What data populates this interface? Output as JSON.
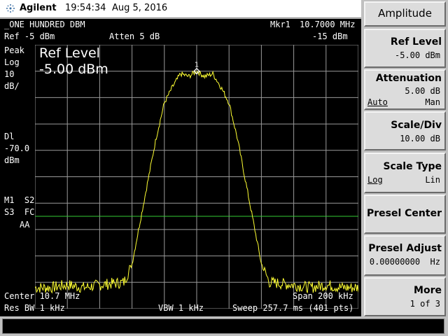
{
  "status_bar": {
    "brand": "Agilent",
    "time": "19:54:34",
    "date": "Aug 5, 2016"
  },
  "display": {
    "title": "_ONE HUNDRED DBM",
    "marker_label": "Mkr1",
    "marker_freq": "10.7000 MHz",
    "ref_label": "Ref -5 dBm",
    "atten_label": "Atten 5 dB",
    "marker_amp": "-15 dBm",
    "left_annotations": {
      "detector": "Peak",
      "scale_mode": "Log",
      "scale_value": "10",
      "scale_unit": "dB/",
      "dl_label": "Dl",
      "dl_value": "-70.0",
      "dl_unit": "dBm",
      "trace_line1": "M1  S2",
      "trace_line2": "S3  FC",
      "trace_line3": "AA"
    },
    "active_function": {
      "label": "Ref Level",
      "value": "-5.00 dBm"
    },
    "marker_number": "1",
    "center": "Center 10.7 MHz",
    "span": "Span 200 kHz",
    "res_bw": "Res BW 1 kHz",
    "vbw": "VBW 1 kHz",
    "sweep": "Sweep 257.7 ms (401 pts)"
  },
  "softkeys": {
    "menu_title": "Amplitude",
    "ref_level": {
      "label": "Ref Level",
      "value": "-5.00 dBm"
    },
    "attenuation": {
      "label": "Attenuation",
      "value": "5.00 dB",
      "auto": "Auto",
      "man": "Man"
    },
    "scale_div": {
      "label": "Scale/Div",
      "value": "10.00 dB"
    },
    "scale_type": {
      "label": "Scale Type",
      "log": "Log",
      "lin": "Lin"
    },
    "presel_center": {
      "label": "Presel Center"
    },
    "presel_adjust": {
      "label": "Presel Adjust",
      "value": "0.00000000  Hz"
    },
    "more": {
      "label": "More",
      "value": "1 of 3"
    }
  },
  "colors": {
    "trace": "#ffff33",
    "display_line": "#33cc33",
    "graticule": "#9a9a9a"
  },
  "chart_data": {
    "type": "line",
    "x_unit": "MHz",
    "y_unit": "dBm",
    "xlim": [
      10.6,
      10.8
    ],
    "ylim": [
      -105,
      -5
    ],
    "display_line_dbm": -70,
    "marker": {
      "label": "1",
      "x": 10.7,
      "y": -15
    },
    "x": [
      10.6,
      10.61,
      10.62,
      10.63,
      10.64,
      10.655,
      10.66,
      10.665,
      10.67,
      10.675,
      10.68,
      10.685,
      10.69,
      10.695,
      10.7,
      10.705,
      10.71,
      10.715,
      10.72,
      10.725,
      10.73,
      10.735,
      10.74,
      10.745,
      10.76,
      10.77,
      10.78,
      10.79,
      10.8
    ],
    "y": [
      -97,
      -97,
      -96,
      -97,
      -96,
      -95,
      -88,
      -72,
      -56,
      -40,
      -27,
      -21,
      -16,
      -17,
      -15,
      -17,
      -16,
      -21,
      -27,
      -40,
      -56,
      -72,
      -88,
      -95,
      -96,
      -97,
      -96,
      -97,
      -97
    ]
  }
}
